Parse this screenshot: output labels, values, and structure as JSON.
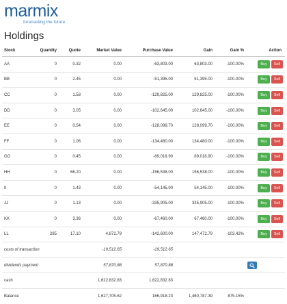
{
  "brand": {
    "name": "marmix",
    "tagline": "forecasting the future"
  },
  "page": {
    "title": "Holdings"
  },
  "table": {
    "headers": {
      "stock": "Stock",
      "quantity": "Quantity",
      "quote": "Quote",
      "market_value": "Market Value",
      "purchase_value": "Purchase Value",
      "gain": "Gain",
      "gain_pct": "Gain %",
      "action": "Action"
    },
    "rows": [
      {
        "stock": "AA",
        "quantity": "0",
        "quote": "0.32",
        "market_value": "0.00",
        "purchase_value": "-63,803.00",
        "gain": "63,803.00",
        "gain_pct": "-100.00%"
      },
      {
        "stock": "BB",
        "quantity": "0",
        "quote": "2.45",
        "market_value": "0.00",
        "purchase_value": "-51,395.00",
        "gain": "51,395.00",
        "gain_pct": "-100.00%"
      },
      {
        "stock": "CC",
        "quantity": "0",
        "quote": "1.58",
        "market_value": "0.00",
        "purchase_value": "-129,825.00",
        "gain": "129,825.00",
        "gain_pct": "-100.00%"
      },
      {
        "stock": "DD",
        "quantity": "0",
        "quote": "3.05",
        "market_value": "0.00",
        "purchase_value": "-102,645.00",
        "gain": "102,645.00",
        "gain_pct": "-100.00%"
      },
      {
        "stock": "EE",
        "quantity": "0",
        "quote": "0.54",
        "market_value": "0.00",
        "purchase_value": "-128,099.70",
        "gain": "128,099.70",
        "gain_pct": "-100.00%"
      },
      {
        "stock": "FF",
        "quantity": "0",
        "quote": "1.06",
        "market_value": "0.00",
        "purchase_value": "-134,480.00",
        "gain": "134,480.00",
        "gain_pct": "-100.00%"
      },
      {
        "stock": "GG",
        "quantity": "0",
        "quote": "0.45",
        "market_value": "0.00",
        "purchase_value": "-89,018.90",
        "gain": "89,018.90",
        "gain_pct": "-100.00%"
      },
      {
        "stock": "HH",
        "quantity": "0",
        "quote": "66.20",
        "market_value": "0.00",
        "purchase_value": "-156,538.00",
        "gain": "156,538.00",
        "gain_pct": "-100.00%"
      },
      {
        "stock": "II",
        "quantity": "0",
        "quote": "1.43",
        "market_value": "0.00",
        "purchase_value": "-54,145.00",
        "gain": "54,145.00",
        "gain_pct": "-100.00%"
      },
      {
        "stock": "JJ",
        "quantity": "0",
        "quote": "1.13",
        "market_value": "0.00",
        "purchase_value": "-335,905.00",
        "gain": "335,905.00",
        "gain_pct": "-100.00%"
      },
      {
        "stock": "KK",
        "quantity": "0",
        "quote": "3.36",
        "market_value": "0.00",
        "purchase_value": "-67,460.00",
        "gain": "67,460.00",
        "gain_pct": "-100.00%"
      },
      {
        "stock": "LL",
        "quantity": "285",
        "quote": "17.10",
        "market_value": "4,872.79",
        "purchase_value": "-142,600.00",
        "gain": "147,472.79",
        "gain_pct": "-103.42%"
      }
    ],
    "buy_label": "Buy",
    "sell_label": "Sell",
    "costs": {
      "label": "costs of transaction",
      "market_value": "-19,512.65",
      "purchase_value": "-19,512.65"
    },
    "dividends": {
      "label": "dividends payment",
      "market_value": "57,870.88",
      "purchase_value": "57,870.88"
    },
    "cash": {
      "label": "cash",
      "market_value": "1,622,832.83",
      "purchase_value": "1,622,832.83"
    },
    "balance": {
      "label": "Balance",
      "market_value": "1,627,705.62",
      "purchase_value": "166,918.23",
      "gain": "1,460,787.39",
      "gain_pct": "875.15%"
    }
  },
  "icons": {
    "search": "search-icon"
  },
  "colors": {
    "brand": "#1f5f9c",
    "positive": "#3a9a2c",
    "negative": "#d9423a",
    "buy": "#4cae4c",
    "sell": "#d9534f",
    "primary": "#337ab7"
  }
}
